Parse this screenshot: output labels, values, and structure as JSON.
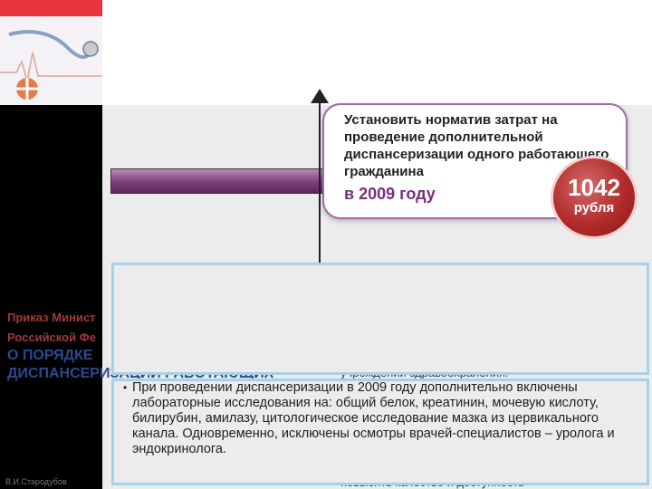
{
  "slide": {
    "callout": {
      "text": "Установить норматив затрат на проведение дополнительной диспансеризации одного работающего гражданина",
      "year": "в 2009 году"
    },
    "badge": {
      "amount": "1042",
      "unit": "рубля"
    },
    "left_titles": {
      "line1": "Приказ Минист",
      "line2": "Российской Фе",
      "line3": "О ПОРЯДКЕ",
      "line4": "ДИСПАНСЕРИЗАЦИИ РАБОТАЮЩИХ"
    },
    "background_text": {
      "line1": "учреждении здравоохранения.",
      "line2": "повысить качество и доступность"
    },
    "box2": {
      "bullet": "•",
      "text": "При проведении диспансеризации в 2009 году дополнительно включены лабораторные исследования на: общий белок, креатинин, мочевую кислоту, билирубин, амилазу, цитологическое исследование мазка из цервикального канала. Одновременно, исключены осмотры врачей-специалистов – уролога и эндокринолога."
    },
    "author": "В.И.Стародубов",
    "colors": {
      "accent_red": "#e8323c",
      "purple": "#7a3f79",
      "badge_red": "#b22b2b",
      "title_blue": "#2a4a90"
    },
    "icons": [
      "stethoscope-logo-icon",
      "medical-emblem-icon"
    ]
  }
}
